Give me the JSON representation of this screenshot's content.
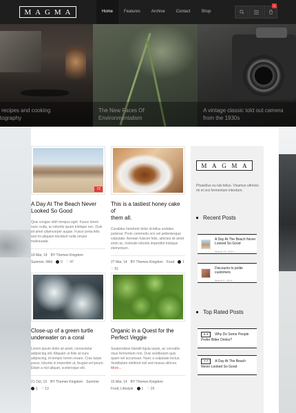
{
  "header": {
    "logo_letters": [
      "M",
      "A",
      "G",
      "M",
      "A"
    ],
    "nav": [
      "Home",
      "Features",
      "Archive",
      "Contact",
      "Shop"
    ],
    "cart_count": "0",
    "icons": [
      "search-icon",
      "menu-icon",
      "cart-icon"
    ]
  },
  "hero": {
    "slides": [
      {
        "caption": "od recipes and cooking\nhotography"
      },
      {
        "caption": "The New Faces Of\nEnvironmentalism"
      },
      {
        "caption": "A vintage classic told out camera\nfrom the 1930s"
      }
    ]
  },
  "posts": [
    {
      "title": "A Day At The Beach Never\nLooked So Good",
      "excerpt": "Quis congue nibh tempus eget. Fusce lorem nunc nulla, ac lobortis quam tristique nec. Duis sit amet ullamcorper augue. Fusce porta felis sed mi aliquam tincidunt nulla ornare malesuada.",
      "number": "72",
      "date": "19 Mar, 14",
      "by": "BY",
      "author": "Themes Kingdom",
      "category": "Summer, Wild",
      "comments": "0",
      "likes": "47"
    },
    {
      "title": "This is a tastiest honey cake of\nthem all.",
      "excerpt": "Curabitur hendrerit dolor id tellus sodales pulvinar. Proin commodo orci vel pellentesque vulputate. Aenean fuiscen felis, ultricies sit amet enim ac, molestie lobortis imperdiet tristique elementum.",
      "date": "27 Mar, 14",
      "by": "BY",
      "author": "Themes Kingdom",
      "category": "Food",
      "comments": "1",
      "likes": "61"
    },
    {
      "title": "Close-up of a green turtle\nunderwater on a coral",
      "excerpt": "Lorem ipsum dolor sit amet, consectetur adipiscing elit. Aliquam ut felis at nunc adipiscing, id tempor lorem ornare. Cras turpis purus, lobortis in imperdiet ut, feugiat vel ipsum. Etiam a nisl aliquet, scelerisque elit.",
      "date": "21 Oct, 13",
      "by": "BY",
      "author": "Themes Kingdom",
      "category": "Summer",
      "comments": "1",
      "likes": "13"
    },
    {
      "title": "Organic in a Quest for the\nPerfect Veggie",
      "excerpt": "Suspendisse blandit ligula turpis, ac convallis risus fermentum non. Duis vestibulum quis quam vel accumsan. Nunc a vulputate lectus. Vestibulum eleifend nisl sed massa ultrices.",
      "more": "More...",
      "date": "15 Mar, 14",
      "by": "BY",
      "author": "Themes Kingdom",
      "category": "Food, Lifestyle",
      "comments": "1",
      "likes": "26"
    }
  ],
  "sidebar": {
    "logo_letters": [
      "M",
      "A",
      "G",
      "M",
      "A"
    ],
    "about": "Phasellus eu nisi tellus. Vivamus ultricies mi et orci fermentum interdum.",
    "recent_heading": "Recent Posts",
    "recent": [
      {
        "title": "A Day At The Beach Never Looked So Good",
        "date": "March 15, 2014"
      },
      {
        "title": "Discounts to polite customers",
        "date": "March 6, 2014"
      }
    ],
    "top_heading": "Top Rated Posts",
    "top": [
      {
        "score": "8.3",
        "title": "Why Do Some People Prefer Bitter Drinks?"
      },
      {
        "score": "7.7",
        "title": "A Day At The Beach Never Looked So Good"
      }
    ]
  },
  "colors": {
    "accent": "#e23c3c",
    "header": "#1e1e1e",
    "sidebar": "#f0f0f0"
  }
}
